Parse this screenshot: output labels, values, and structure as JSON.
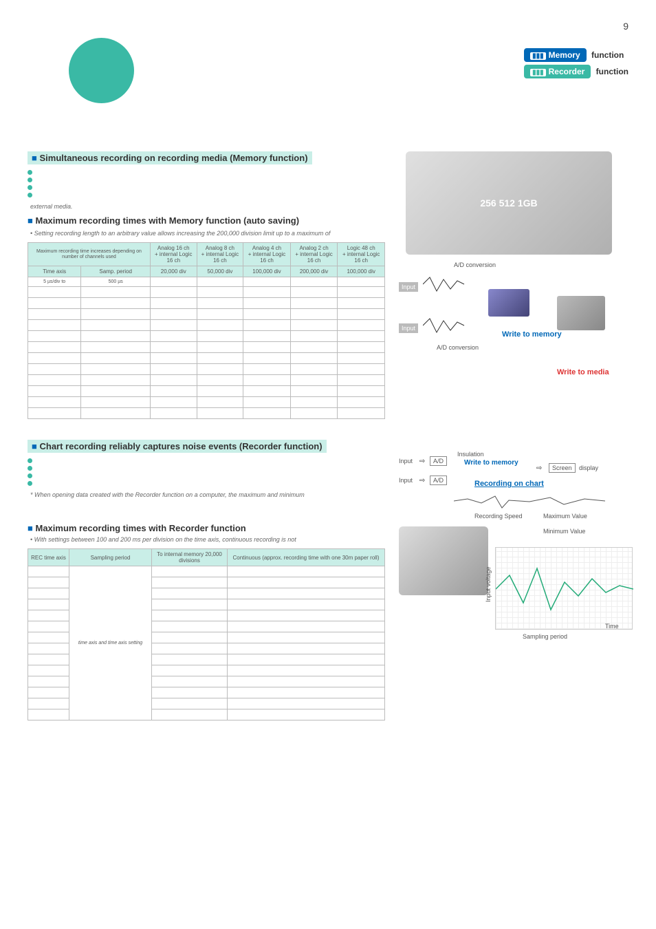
{
  "pagenum": "9",
  "topfunc": {
    "mem_pill": "Memory",
    "rec_pill": "Recorder",
    "func_word": "function"
  },
  "section1": {
    "title": "Simultaneous recording on recording media (Memory function)",
    "note_ext": "external media."
  },
  "section2": {
    "title": "Maximum recording times with Memory function (auto saving)",
    "note_setting": "Setting recording length to an arbitrary value allows increasing the 200,000 division limit up to a maximum of"
  },
  "mem_table": {
    "corner": "Maximum recording time increases depending on number of channels used",
    "head": [
      {
        "a": "Analog 16 ch",
        "b": "+ internal Logic 16 ch"
      },
      {
        "a": "Analog 8 ch",
        "b": "+ internal Logic 16 ch"
      },
      {
        "a": "Analog 4 ch",
        "b": "+ internal Logic 16 ch"
      },
      {
        "a": "Analog 2 ch",
        "b": "+ internal Logic 16 ch"
      },
      {
        "a": "Logic 48 ch",
        "b": "+ internal Logic 16 ch"
      }
    ],
    "sub_left_a": "Time axis",
    "sub_left_b": "Samp. period",
    "div_row": [
      "20,000 div",
      "50,000 div",
      "100,000 div",
      "200,000 div",
      "100,000 div"
    ],
    "first_axis": "5 µs/div to",
    "first_period": "500 µs"
  },
  "diagram1": {
    "ad": "A/D conversion",
    "input": "Input",
    "write_mem": "Write to memory",
    "write_media": "Write to media"
  },
  "section3": {
    "title": "Chart recording reliably captures noise events (Recorder function)",
    "footnote": "* When opening data created with the Recorder function on a computer, the maximum and minimum"
  },
  "section4": {
    "title": "Maximum recording times with Recorder function",
    "note": "• With settings between 100 and 200 ms per division on the time axis, continuous recording is not"
  },
  "rec_table": {
    "h1": "REC time axis",
    "h2": "Sampling period",
    "h3": "To internal memory 20,000 divisions",
    "h4": "Continuous (approx. recording time with one 30m paper roll)",
    "samp_note": "time axis and time axis setting"
  },
  "diagram2": {
    "input": "Input",
    "ad": "A/D",
    "insul": "Insulation",
    "write_mem": "Write to memory",
    "screen": "Screen",
    "display": "display",
    "rec_chart": "Recording on chart",
    "recspeed": "Recording Speed",
    "maxv": "Maximum Value",
    "minv": "Minimum Value",
    "samp": "Sampling period",
    "time": "Time",
    "involt": "Input voltage"
  }
}
